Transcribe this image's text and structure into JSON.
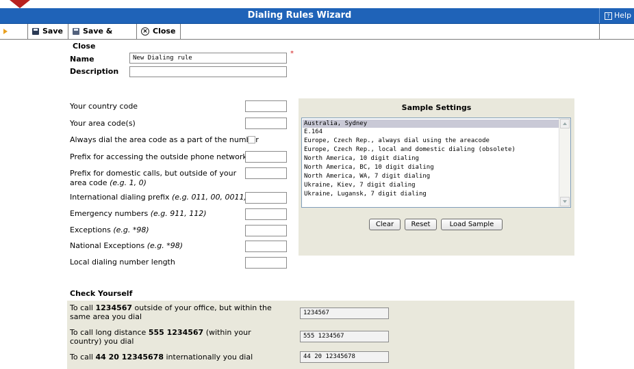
{
  "window": {
    "title": "Dialing Rules Wizard",
    "help_label": "Help"
  },
  "toolbar": {
    "save_label": "Save",
    "save_close_label": "Save & Close",
    "close_label": "Close"
  },
  "form": {
    "name_label": "Name",
    "name_value": "New Dialing rule",
    "description_label": "Description",
    "description_value": "",
    "required_mark": "*"
  },
  "fields": {
    "country_code": {
      "label": "Your country code",
      "value": ""
    },
    "area_codes": {
      "label": "Your area code(s)",
      "value": ""
    },
    "always_dial_area": {
      "label": "Always dial the area code as a part of the number",
      "checked": false
    },
    "outside_prefix": {
      "label": "Prefix for accessing the outside phone network",
      "value": ""
    },
    "domestic_prefix": {
      "label_main": "Prefix for domestic calls, but outside of your area code",
      "label_hint": "(e.g. 1, 0)",
      "value": ""
    },
    "intl_prefix": {
      "label_main": "International dialing prefix",
      "label_hint": "(e.g. 011, 00, 0011)",
      "value": ""
    },
    "emergency": {
      "label_main": "Emergency numbers",
      "label_hint": "(e.g. 911, 112)",
      "value": ""
    },
    "exceptions": {
      "label_main": "Exceptions",
      "label_hint": "(e.g. *98)",
      "value": ""
    },
    "national_exceptions": {
      "label_main": "National Exceptions",
      "label_hint": "(e.g. *98)",
      "value": ""
    },
    "local_length": {
      "label": "Local dialing number length",
      "value": ""
    }
  },
  "samples": {
    "title": "Sample Settings",
    "items": [
      "Australia, Sydney",
      "E.164",
      "Europe, Czech Rep., always dial using the areacode",
      "Europe, Czech Rep., local and domestic dialing (obsolete)",
      "North America, 10 digit dialing",
      "North America, BC, 10 digit dialing",
      "North America, WA, 7 digit dialing",
      "Ukraine, Kiev, 7 digit dialing",
      "Ukraine, Lugansk, 7 digit dialing"
    ],
    "selected": "Australia, Sydney",
    "clear_label": "Clear",
    "reset_label": "Reset",
    "load_label": "Load Sample"
  },
  "check": {
    "title": "Check Yourself",
    "rows": [
      {
        "pre": "To call ",
        "num": "1234567",
        "post": " outside of your office, but within the same area you dial",
        "result": "1234567"
      },
      {
        "pre": "To call long distance ",
        "num": "555 1234567",
        "post": " (within your country) you dial",
        "result": "555 1234567"
      },
      {
        "pre": "To call ",
        "num": "44 20 12345678",
        "post": " internationally you dial",
        "result": "44 20 12345678"
      }
    ]
  },
  "colors": {
    "titlebar": "#1f63b8",
    "panel": "#e9e8dc",
    "accent_arrow": "#b8211f",
    "required": "#d21b1b"
  }
}
